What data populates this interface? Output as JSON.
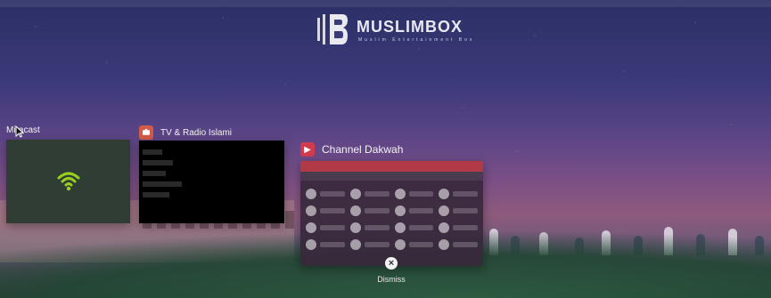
{
  "branding": {
    "logo_word": "MUSLIMBOX",
    "logo_tagline": "Muslim Entertainment Box"
  },
  "recents": {
    "cards": [
      {
        "title": "Miracast",
        "icon": "miracast-icon"
      },
      {
        "title": "TV & Radio Islami",
        "icon": "tv-radio-app-icon"
      },
      {
        "title": "Channel Dakwah",
        "icon": "youtube-play-icon"
      }
    ],
    "dismiss_label": "Dismiss"
  },
  "colors": {
    "tv_app_icon_bg": "#d35a48",
    "dakwah_icon_bg": "#d03b4d",
    "wifi_green": "#9ad01d"
  }
}
